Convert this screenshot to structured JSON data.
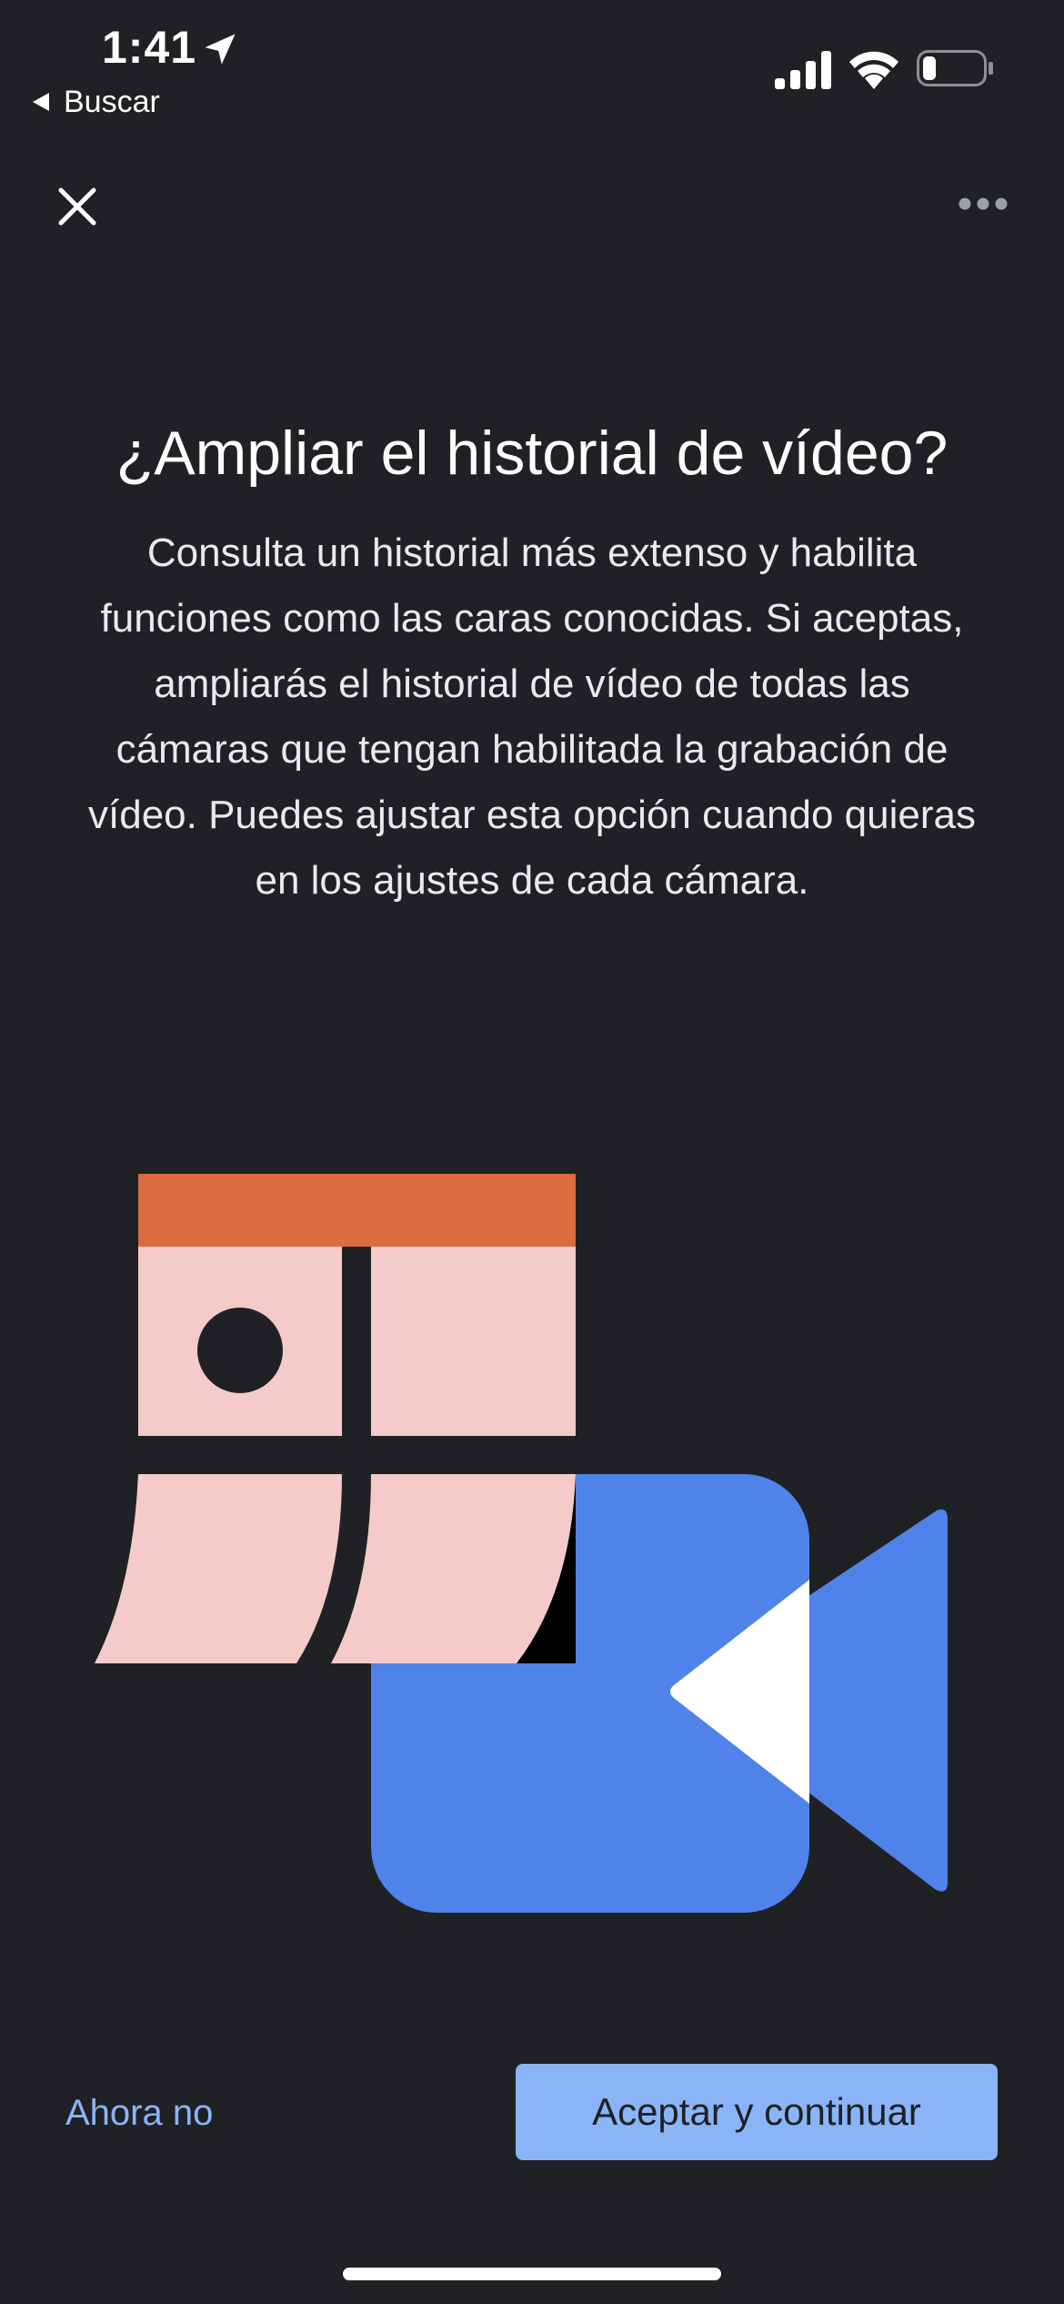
{
  "status_bar": {
    "time": "1:41",
    "back_app_label": "Buscar",
    "icons": [
      "location-arrow-icon",
      "cellular-signal-icon",
      "wifi-icon",
      "battery-low-icon"
    ]
  },
  "top_bar": {
    "close_icon": "close-icon",
    "more_icon": "more-horizontal-icon"
  },
  "dialog": {
    "title": "¿Ampliar el historial de vídeo?",
    "description": "Consulta un historial más extenso y habilita funciones como las caras conocidas. Si aceptas, ampliarás el historial de vídeo de todas las cámaras que tengan habilitada la grabación de vídeo. Puedes ajustar esta opción cuando quieras en los ajustes de cada cámara."
  },
  "illustration": {
    "subject": "calendar-and-video-camera",
    "colors": {
      "calendar_header": "#db6c40",
      "calendar_cells": "#f4cbc9",
      "camera": "#5083e9",
      "accent_white": "#ffffff",
      "dark": "#202124"
    }
  },
  "actions": {
    "secondary_label": "Ahora no",
    "primary_label": "Aceptar y continuar"
  },
  "colors": {
    "background": "#202124",
    "accent": "#8ab4f8",
    "text": "#ffffff"
  }
}
